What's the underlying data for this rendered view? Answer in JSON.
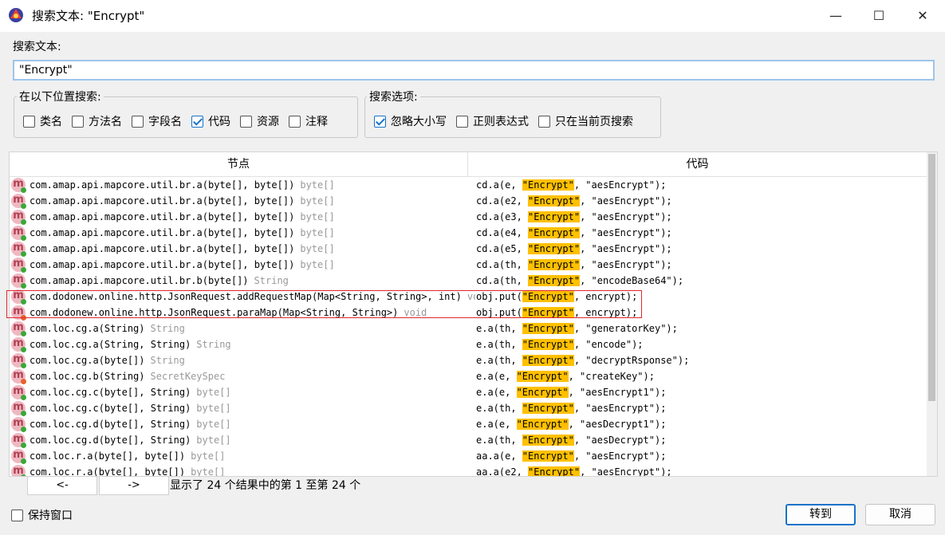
{
  "window": {
    "title": "搜索文本: \"Encrypt\"",
    "minimize": "—",
    "maximize": "☐",
    "close": "✕"
  },
  "search": {
    "label": "搜索文本:",
    "value": "\"Encrypt\""
  },
  "location_group": {
    "legend": "在以下位置搜索:",
    "options": [
      {
        "label": "类名",
        "checked": false
      },
      {
        "label": "方法名",
        "checked": false
      },
      {
        "label": "字段名",
        "checked": false
      },
      {
        "label": "代码",
        "checked": true
      },
      {
        "label": "资源",
        "checked": false
      },
      {
        "label": "注释",
        "checked": false
      }
    ]
  },
  "options_group": {
    "legend": "搜索选项:",
    "options": [
      {
        "label": "忽略大小写",
        "checked": true
      },
      {
        "label": "正则表达式",
        "checked": false
      },
      {
        "label": "只在当前页搜索",
        "checked": false
      }
    ]
  },
  "table": {
    "col_node": "节点",
    "col_code": "代码",
    "rows": [
      {
        "node": "com.amap.api.mapcore.util.br.a(byte[], byte[])",
        "ret": "byte[]",
        "dot": "green",
        "pre": "cd.a(e, ",
        "kw": "\"Encrypt\"",
        "post": ", \"aesEncrypt\");"
      },
      {
        "node": "com.amap.api.mapcore.util.br.a(byte[], byte[])",
        "ret": "byte[]",
        "dot": "green",
        "pre": "cd.a(e2, ",
        "kw": "\"Encrypt\"",
        "post": ", \"aesEncrypt\");"
      },
      {
        "node": "com.amap.api.mapcore.util.br.a(byte[], byte[])",
        "ret": "byte[]",
        "dot": "green",
        "pre": "cd.a(e3, ",
        "kw": "\"Encrypt\"",
        "post": ", \"aesEncrypt\");"
      },
      {
        "node": "com.amap.api.mapcore.util.br.a(byte[], byte[])",
        "ret": "byte[]",
        "dot": "green",
        "pre": "cd.a(e4, ",
        "kw": "\"Encrypt\"",
        "post": ", \"aesEncrypt\");"
      },
      {
        "node": "com.amap.api.mapcore.util.br.a(byte[], byte[])",
        "ret": "byte[]",
        "dot": "green",
        "pre": "cd.a(e5, ",
        "kw": "\"Encrypt\"",
        "post": ", \"aesEncrypt\");"
      },
      {
        "node": "com.amap.api.mapcore.util.br.a(byte[], byte[])",
        "ret": "byte[]",
        "dot": "green",
        "pre": "cd.a(th, ",
        "kw": "\"Encrypt\"",
        "post": ", \"aesEncrypt\");"
      },
      {
        "node": "com.amap.api.mapcore.util.br.b(byte[])",
        "ret": "String",
        "dot": "green",
        "pre": "cd.a(th, ",
        "kw": "\"Encrypt\"",
        "post": ", \"encodeBase64\");"
      },
      {
        "node": "com.dodonew.online.http.JsonRequest.addRequestMap(Map<String, String>, int)",
        "ret": "void",
        "dot": "green",
        "pre": "obj.put(",
        "kw": "\"Encrypt\"",
        "post": ", encrypt);"
      },
      {
        "node": "com.dodonew.online.http.JsonRequest.paraMap(Map<String, String>)",
        "ret": "void",
        "dot": "red",
        "pre": "obj.put(",
        "kw": "\"Encrypt\"",
        "post": ", encrypt);"
      },
      {
        "node": "com.loc.cg.a(String)",
        "ret": "String",
        "dot": "green",
        "pre": "e.a(th, ",
        "kw": "\"Encrypt\"",
        "post": ", \"generatorKey\");"
      },
      {
        "node": "com.loc.cg.a(String, String)",
        "ret": "String",
        "dot": "green",
        "pre": "e.a(th, ",
        "kw": "\"Encrypt\"",
        "post": ", \"encode\");"
      },
      {
        "node": "com.loc.cg.a(byte[])",
        "ret": "String",
        "dot": "green",
        "pre": "e.a(th, ",
        "kw": "\"Encrypt\"",
        "post": ", \"decryptRsponse\");"
      },
      {
        "node": "com.loc.cg.b(String)",
        "ret": "SecretKeySpec",
        "dot": "red",
        "pre": "e.a(e, ",
        "kw": "\"Encrypt\"",
        "post": ", \"createKey\");"
      },
      {
        "node": "com.loc.cg.c(byte[], String)",
        "ret": "byte[]",
        "dot": "green",
        "pre": "e.a(e, ",
        "kw": "\"Encrypt\"",
        "post": ", \"aesEncrypt1\");"
      },
      {
        "node": "com.loc.cg.c(byte[], String)",
        "ret": "byte[]",
        "dot": "green",
        "pre": "e.a(th, ",
        "kw": "\"Encrypt\"",
        "post": ", \"aesEncrypt\");"
      },
      {
        "node": "com.loc.cg.d(byte[], String)",
        "ret": "byte[]",
        "dot": "green",
        "pre": "e.a(e, ",
        "kw": "\"Encrypt\"",
        "post": ", \"aesDecrypt1\");"
      },
      {
        "node": "com.loc.cg.d(byte[], String)",
        "ret": "byte[]",
        "dot": "green",
        "pre": "e.a(th, ",
        "kw": "\"Encrypt\"",
        "post": ", \"aesDecrypt\");"
      },
      {
        "node": "com.loc.r.a(byte[], byte[])",
        "ret": "byte[]",
        "dot": "green",
        "pre": "aa.a(e, ",
        "kw": "\"Encrypt\"",
        "post": ", \"aesEncrypt\");"
      },
      {
        "node": "com.loc.r.a(byte[], byte[])",
        "ret": "byte[]",
        "dot": "green",
        "pre": "aa.a(e2, ",
        "kw": "\"Encrypt\"",
        "post": ", \"aesEncrypt\");"
      }
    ]
  },
  "nav": {
    "prev": "<-",
    "next": "->",
    "results": "显示了 24 个结果中的第 1 至第 24 个"
  },
  "footer": {
    "keep_window": "保持窗口",
    "keep_window_checked": false,
    "goto": "转到",
    "cancel": "取消"
  },
  "colors": {
    "highlight": "#ffc000",
    "accent": "#1a73c9",
    "annotation_box": "#e0262e"
  }
}
